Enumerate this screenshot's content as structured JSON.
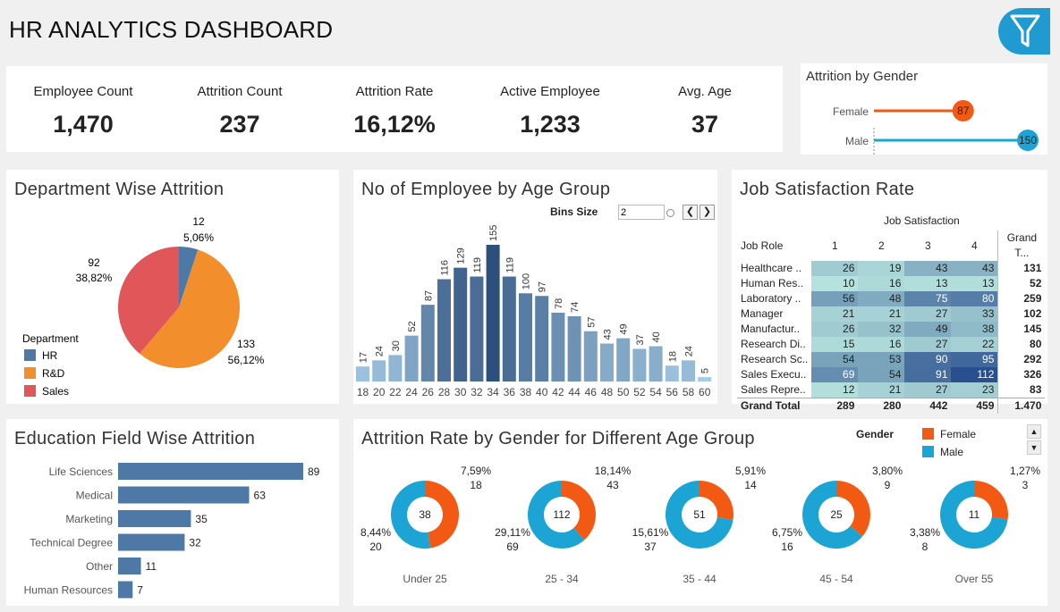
{
  "title": "HR ANALYTICS DASHBOARD",
  "kpis": [
    {
      "label": "Employee Count",
      "value": "1,470"
    },
    {
      "label": "Attrition Count",
      "value": "237"
    },
    {
      "label": "Attrition Rate",
      "value": "16,12%"
    },
    {
      "label": "Active Employee",
      "value": "1,233"
    },
    {
      "label": "Avg. Age",
      "value": "37"
    }
  ],
  "colors": {
    "hr": "#4e79a7",
    "rd": "#f28e2b",
    "sales": "#e15759",
    "female": "#f25a13",
    "male": "#1ca4d4",
    "bar": "#4e79a7",
    "accent": "#1f9bd1"
  },
  "chart_data": [
    {
      "type": "lollipop",
      "title": "Attrition by Gender",
      "categories": [
        "Female",
        "Male"
      ],
      "values": [
        87,
        150
      ],
      "labels": [
        "87",
        "150"
      ],
      "xlim": [
        0,
        150
      ]
    },
    {
      "type": "pie",
      "title": "Department Wise Attrition",
      "legend_title": "Department",
      "categories": [
        "HR",
        "R&D",
        "Sales"
      ],
      "values": [
        12,
        133,
        92
      ],
      "percent_labels": [
        "5,06%",
        "56,12%",
        "38,82%"
      ],
      "value_labels": [
        "12",
        "133",
        "92"
      ],
      "legend_position": "bottom-left"
    },
    {
      "type": "bar",
      "title": "No of Employee by Age Group",
      "bins_label": "Bins Size",
      "bins_value": "2",
      "categories": [
        "18",
        "20",
        "22",
        "24",
        "26",
        "28",
        "30",
        "32",
        "34",
        "36",
        "38",
        "40",
        "42",
        "44",
        "46",
        "48",
        "50",
        "52",
        "54",
        "56",
        "58",
        "60"
      ],
      "values": [
        17,
        24,
        30,
        52,
        87,
        116,
        129,
        119,
        155,
        119,
        100,
        97,
        78,
        74,
        57,
        43,
        49,
        37,
        40,
        18,
        24,
        5
      ],
      "ylim": [
        0,
        155
      ]
    },
    {
      "type": "table",
      "title": "Job Satisfaction Rate",
      "column_group": "Job Satisfaction",
      "row_header": "Job Role",
      "columns": [
        "1",
        "2",
        "3",
        "4"
      ],
      "grand_total_header": "Grand T...",
      "rows": [
        {
          "role": "Healthcare ..",
          "values": [
            26,
            19,
            43,
            43
          ],
          "total": "131"
        },
        {
          "role": "Human Res..",
          "values": [
            10,
            16,
            13,
            13
          ],
          "total": "52"
        },
        {
          "role": "Laboratory ..",
          "values": [
            56,
            48,
            75,
            80
          ],
          "total": "259"
        },
        {
          "role": "Manager",
          "values": [
            21,
            21,
            27,
            33
          ],
          "total": "102"
        },
        {
          "role": "Manufactur..",
          "values": [
            26,
            32,
            49,
            38
          ],
          "total": "145"
        },
        {
          "role": "Research Di..",
          "values": [
            15,
            16,
            27,
            22
          ],
          "total": "80"
        },
        {
          "role": "Research Sc..",
          "values": [
            54,
            53,
            90,
            95
          ],
          "total": "292"
        },
        {
          "role": "Sales Execu..",
          "values": [
            69,
            54,
            91,
            112
          ],
          "total": "326"
        },
        {
          "role": "Sales Repre..",
          "values": [
            12,
            21,
            27,
            23
          ],
          "total": "83"
        }
      ],
      "grand_total_row": {
        "label": "Grand Total",
        "values": [
          "289",
          "280",
          "442",
          "459"
        ],
        "total": "1.470"
      }
    },
    {
      "type": "bar",
      "orientation": "horizontal",
      "title": "Education Field Wise Attrition",
      "categories": [
        "Life Sciences",
        "Medical",
        "Marketing",
        "Technical Degree",
        "Other",
        "Human Resources"
      ],
      "values": [
        89,
        63,
        35,
        32,
        11,
        7
      ],
      "xlim": [
        0,
        89
      ]
    },
    {
      "type": "pie",
      "style": "donut",
      "title": "Attrition Rate by Gender for Different Age Group",
      "legend_title": "Gender",
      "series_names": [
        "Female",
        "Male"
      ],
      "groups": [
        {
          "label": "Under 25",
          "total": "38",
          "female": 18,
          "male": 20,
          "female_pct": "7,59%",
          "male_pct": "8,44%"
        },
        {
          "label": "25 - 34",
          "total": "112",
          "female": 43,
          "male": 69,
          "female_pct": "18,14%",
          "male_pct": "29,11%"
        },
        {
          "label": "35 - 44",
          "total": "51",
          "female": 14,
          "male": 37,
          "female_pct": "5,91%",
          "male_pct": "15,61%"
        },
        {
          "label": "45 - 54",
          "total": "25",
          "female": 9,
          "male": 16,
          "female_pct": "3,80%",
          "male_pct": "6,75%"
        },
        {
          "label": "Over 55",
          "total": "11",
          "female": 3,
          "male": 8,
          "female_pct": "1,27%",
          "male_pct": "3,38%"
        }
      ]
    }
  ]
}
